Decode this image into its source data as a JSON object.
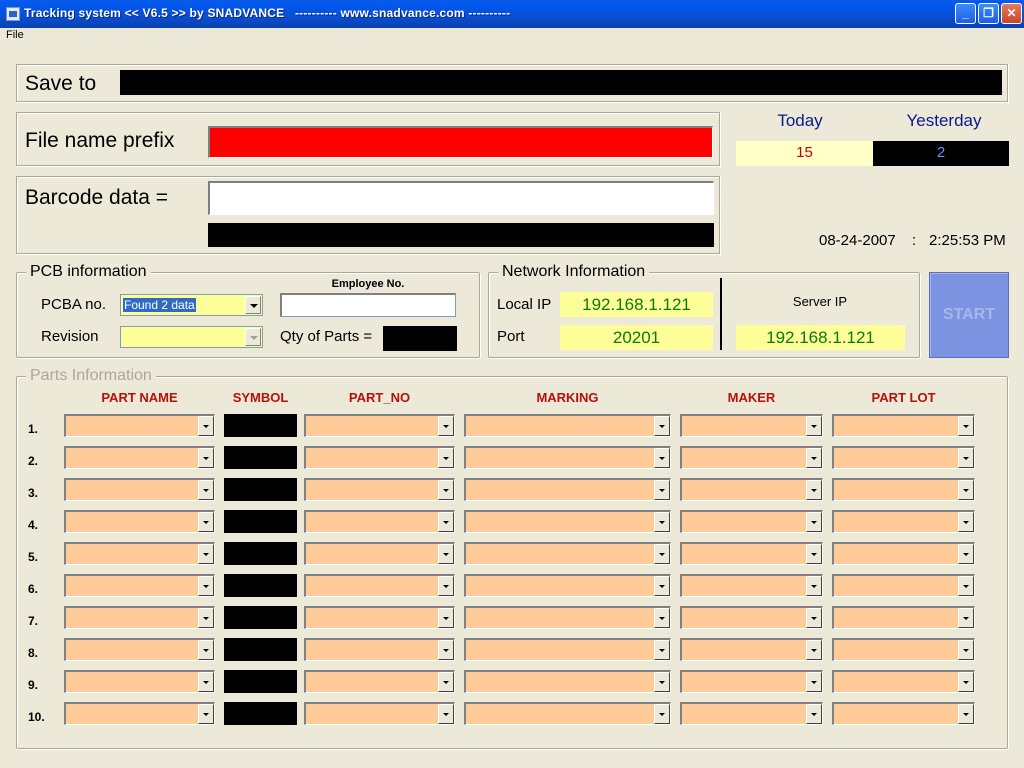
{
  "window": {
    "title": "Tracking system << V6.5 >> by SNADVANCE   ---------- www.snadvance.com ----------",
    "minimize": "_",
    "maximize": "❐",
    "close": "✕"
  },
  "menu": {
    "file": "File"
  },
  "save_to": {
    "label": "Save to"
  },
  "file_prefix": {
    "label": "File name prefix",
    "color": "#ff0000"
  },
  "barcode": {
    "label": "Barcode data =",
    "value": ""
  },
  "counters": {
    "today_label": "Today",
    "yesterday_label": "Yesterday",
    "today_value": "15",
    "yesterday_value": "2",
    "today_color": "#cc0000",
    "yesterday_color": "#6a8cff"
  },
  "datetime": {
    "date": "08-24-2007",
    "separator": ":",
    "time": "2:25:53 PM"
  },
  "pcb": {
    "legend": "PCB information",
    "pcba_label": "PCBA no.",
    "pcba_value": "Found 2 data",
    "revision_label": "Revision",
    "revision_value": "",
    "employee_label": "Employee No.",
    "employee_value": "",
    "qty_label": "Qty of Parts ="
  },
  "network": {
    "legend": "Network Information",
    "local_ip_label": "Local IP",
    "local_ip": "192.168.1.121",
    "port_label": "Port",
    "port": "20201",
    "server_ip_label": "Server IP",
    "server_ip": "192.168.1.121"
  },
  "start_button": "START",
  "parts": {
    "legend": "Parts Information",
    "columns": [
      "PART NAME",
      "SYMBOL",
      "PART_NO",
      "MARKING",
      "MAKER",
      "PART LOT"
    ],
    "rows": [
      "1.",
      "2.",
      "3.",
      "4.",
      "5.",
      "6.",
      "7.",
      "8.",
      "9.",
      "10."
    ],
    "combo_color": "#ffcc99",
    "header_color": "#b8100a"
  }
}
